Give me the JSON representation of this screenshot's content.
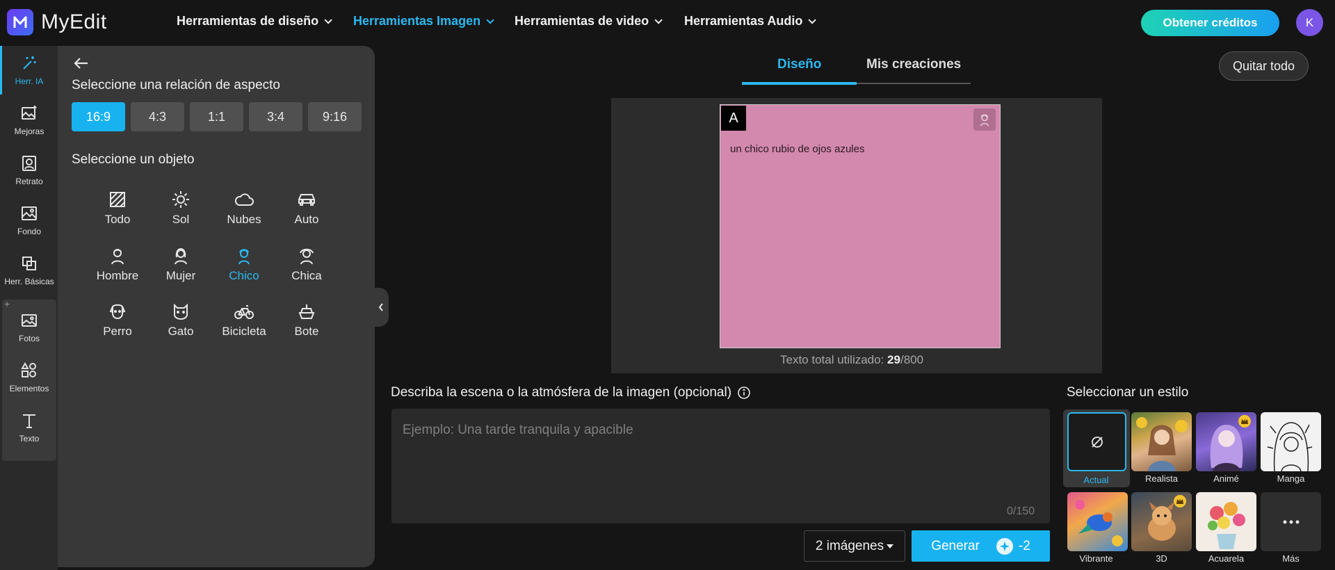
{
  "app": {
    "name": "MyEdit",
    "avatar_initial": "K",
    "accent": "#2bb8f0"
  },
  "nav": {
    "items": [
      {
        "label": "Herramientas de diseño",
        "active": false
      },
      {
        "label": "Herramientas Imagen",
        "active": true
      },
      {
        "label": "Herramientas de video",
        "active": false
      },
      {
        "label": "Herramientas Audio",
        "active": false
      }
    ],
    "credits_button": "Obtener créditos"
  },
  "rail": {
    "items": [
      {
        "label": "Herr. IA",
        "icon": "magic-wand-icon",
        "active": true
      },
      {
        "label": "Mejoras",
        "icon": "image-enhance-icon"
      },
      {
        "label": "Retrato",
        "icon": "portrait-icon"
      },
      {
        "label": "Fondo",
        "icon": "background-icon"
      },
      {
        "label": "Herr. Básicas",
        "icon": "basic-tools-icon"
      },
      {
        "label": "Fotos",
        "icon": "photos-icon"
      },
      {
        "label": "Elementos",
        "icon": "elements-icon"
      },
      {
        "label": "Texto",
        "icon": "text-icon"
      }
    ],
    "group_add": "+"
  },
  "panel": {
    "aspect_heading": "Seleccione una relación de aspecto",
    "aspect_ratios": [
      {
        "label": "16:9",
        "active": true
      },
      {
        "label": "4:3"
      },
      {
        "label": "1:1"
      },
      {
        "label": "3:4"
      },
      {
        "label": "9:16"
      }
    ],
    "object_heading": "Seleccione un objeto",
    "objects": [
      {
        "label": "Todo",
        "icon": "all-icon"
      },
      {
        "label": "Sol",
        "icon": "sun-icon"
      },
      {
        "label": "Nubes",
        "icon": "cloud-icon"
      },
      {
        "label": "Auto",
        "icon": "car-icon"
      },
      {
        "label": "Hombre",
        "icon": "man-icon"
      },
      {
        "label": "Mujer",
        "icon": "woman-icon"
      },
      {
        "label": "Chico",
        "icon": "boy-icon",
        "active": true
      },
      {
        "label": "Chica",
        "icon": "girl-icon"
      },
      {
        "label": "Perro",
        "icon": "dog-icon"
      },
      {
        "label": "Gato",
        "icon": "cat-icon"
      },
      {
        "label": "Bicicleta",
        "icon": "bicycle-icon"
      },
      {
        "label": "Bote",
        "icon": "boat-icon"
      }
    ]
  },
  "main": {
    "tabs": [
      {
        "label": "Diseño",
        "active": true
      },
      {
        "label": "Mis creaciones",
        "active": false
      }
    ],
    "clear_button": "Quitar todo",
    "canvas": {
      "badge": "A",
      "object_text": "un chico rubio de ojos azules",
      "text_used_label": "Texto total utilizado:",
      "text_used": "29",
      "text_max": "/800",
      "card_color": "#d388ad"
    },
    "description": {
      "label": "Describa la escena o la atmósfera de la imagen (opcional)",
      "placeholder": "Ejemplo: Una tarde tranquila y apacible",
      "value": "",
      "counter": "0/150"
    },
    "image_count": "2 imágenes",
    "generate": {
      "label": "Generar",
      "cost": "-2"
    }
  },
  "styles": {
    "heading": "Seleccionar un estilo",
    "items": [
      {
        "label": "Actual",
        "active": true
      },
      {
        "label": "Realista"
      },
      {
        "label": "Animé",
        "premium": true
      },
      {
        "label": "Manga"
      },
      {
        "label": "Vibrante"
      },
      {
        "label": "3D",
        "premium": true
      },
      {
        "label": "Acuarela"
      },
      {
        "label": "Más"
      }
    ]
  }
}
